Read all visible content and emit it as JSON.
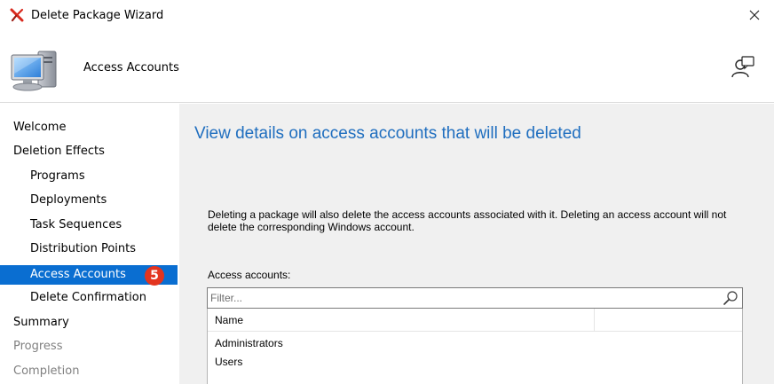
{
  "window": {
    "title": "Delete Package Wizard"
  },
  "header": {
    "heading": "Access Accounts"
  },
  "sidebar": {
    "items": [
      {
        "label": "Welcome"
      },
      {
        "label": "Deletion Effects"
      },
      {
        "label": "Programs"
      },
      {
        "label": "Deployments"
      },
      {
        "label": "Task Sequences"
      },
      {
        "label": "Distribution Points"
      },
      {
        "label": "Access Accounts"
      },
      {
        "label": "Delete Confirmation"
      },
      {
        "label": "Summary"
      },
      {
        "label": "Progress"
      },
      {
        "label": "Completion"
      }
    ],
    "step_badge": "5"
  },
  "main": {
    "title": "View details on access accounts that will be deleted",
    "description": "Deleting a package will also delete the access accounts associated with it. Deleting an access account will not delete the corresponding Windows account.",
    "list_label": "Access accounts:",
    "filter": {
      "placeholder": "Filter..."
    },
    "table": {
      "columns": [
        "Name"
      ],
      "rows": [
        {
          "name": "Administrators"
        },
        {
          "name": "Users"
        }
      ]
    }
  },
  "colors": {
    "accent": "#0a6ed1",
    "title_blue": "#1f6ebf",
    "badge_red": "#e3341f",
    "panel_bg": "#f0f0f0",
    "disabled_text": "#808080"
  },
  "icons": {
    "app": "red-x-icon",
    "close": "close-icon",
    "header": "computer-icon",
    "help": "help-user-icon",
    "filter": "search-icon"
  }
}
